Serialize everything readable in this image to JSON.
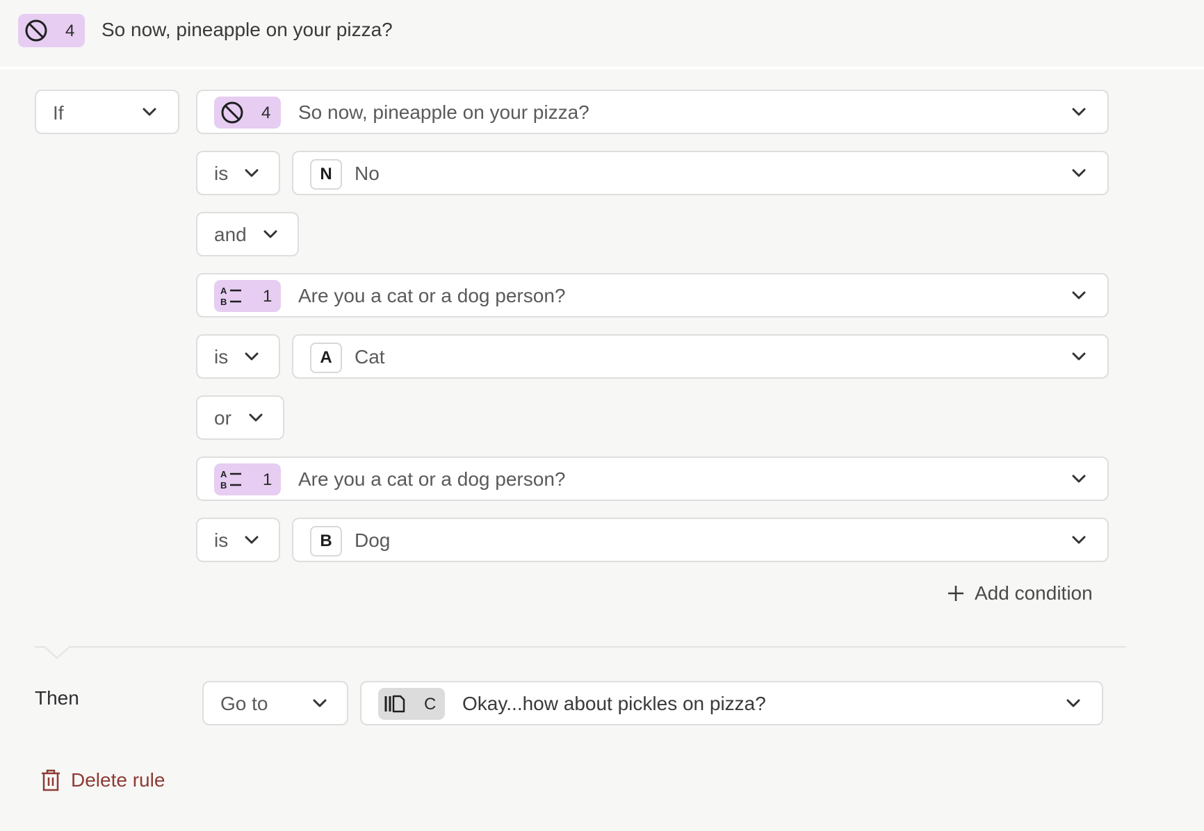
{
  "header": {
    "question_number": "4",
    "question_icon": "no-symbol-icon",
    "title": "So now, pineapple on your pizza?"
  },
  "rule": {
    "if_label": "If",
    "conditions": [
      {
        "question_icon": "no-symbol-icon",
        "question_number": "4",
        "question_text": "So now, pineapple on your pizza?",
        "operator": "is",
        "answer_letter": "N",
        "answer_text": "No"
      },
      {
        "connector": "and",
        "question_icon": "multiple-choice-icon",
        "question_number": "1",
        "question_text": "Are you a cat or a dog person?",
        "operator": "is",
        "answer_letter": "A",
        "answer_text": "Cat"
      },
      {
        "connector": "or",
        "question_icon": "multiple-choice-icon",
        "question_number": "1",
        "question_text": "Are you a cat or a dog person?",
        "operator": "is",
        "answer_letter": "B",
        "answer_text": "Dog"
      }
    ],
    "add_condition_label": "Add condition",
    "then_label": "Then",
    "action_label": "Go to",
    "target_icon": "statement-icon",
    "target_number": "C",
    "target_text": "Okay...how about pickles on pizza?",
    "delete_label": "Delete rule"
  },
  "colors": {
    "background": "#f7f7f6",
    "badge_purple": "#e6cdf1",
    "badge_gray": "#dcdcdc",
    "delete_red": "#8e3a34",
    "field_border": "#dedede"
  }
}
